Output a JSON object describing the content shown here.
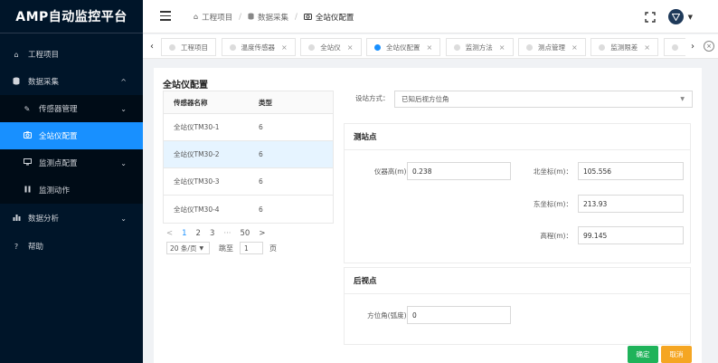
{
  "app": {
    "title": "AMP自动监控平台"
  },
  "sidebar": {
    "items": [
      {
        "label": "工程项目",
        "icon": "home-icon"
      },
      {
        "label": "数据采集",
        "icon": "database-icon",
        "expanded": true
      },
      {
        "label": "传感器管理",
        "icon": "wrench-icon"
      },
      {
        "label": "全站仪配置",
        "icon": "camera-icon",
        "active": true
      },
      {
        "label": "监测点配置",
        "icon": "monitor-icon"
      },
      {
        "label": "监测动作",
        "icon": "pause-icon"
      },
      {
        "label": "数据分析",
        "icon": "bar-chart-icon"
      },
      {
        "label": "帮助",
        "icon": "question-icon"
      }
    ]
  },
  "header": {
    "breadcrumb": [
      "工程项目",
      "数据采集",
      "全站仪配置"
    ]
  },
  "tabs": [
    {
      "label": "工程项目"
    },
    {
      "label": "温度传感器"
    },
    {
      "label": "全站仪"
    },
    {
      "label": "全站仪配置",
      "active": true
    },
    {
      "label": "监测方法"
    },
    {
      "label": "测点管理"
    },
    {
      "label": "监测限差"
    },
    {
      "label": ""
    }
  ],
  "page": {
    "title": "全站仪配置",
    "table": {
      "headers": [
        "传感器名称",
        "类型"
      ],
      "rows": [
        {
          "name": "全站仪TM30-1",
          "type": "6"
        },
        {
          "name": "全站仪TM30-2",
          "type": "6",
          "selected": true
        },
        {
          "name": "全站仪TM30-3",
          "type": "6"
        },
        {
          "name": "全站仪TM30-4",
          "type": "6"
        }
      ]
    },
    "pagination": {
      "prev": "<",
      "pages": [
        "1",
        "2",
        "3",
        "···",
        "50"
      ],
      "next": ">",
      "page_size": "20 条/页",
      "jump_label": "跳至",
      "jump_value": "1",
      "page_unit": "页"
    },
    "form": {
      "method_label": "设站方式：",
      "method_value": "已知后视方位角",
      "station": {
        "title": "测站点",
        "instrument_height_label": "仪器高(m)：",
        "instrument_height": "0.238",
        "north_label": "北坐标(m)：",
        "north": "105.556",
        "east_label": "东坐标(m)：",
        "east": "213.93",
        "elevation_label": "高程(m)：",
        "elevation": "99.145"
      },
      "backsight": {
        "title": "后视点",
        "azimuth_label": "方位角(弧度)：",
        "azimuth": "0"
      },
      "ok_label": "确定",
      "cancel_label": "取消"
    }
  },
  "colors": {
    "sidebar_bg": "#001529",
    "accent": "#1890ff",
    "ok": "#1fb35a",
    "cancel": "#f5a623"
  }
}
